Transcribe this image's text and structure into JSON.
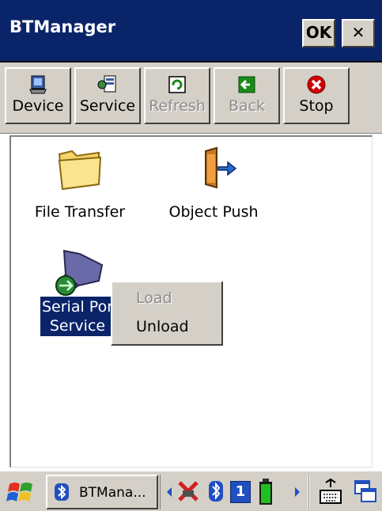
{
  "window": {
    "title": "BTManager",
    "ok_label": "OK",
    "close_symbol": "✕"
  },
  "toolbar": {
    "buttons": [
      {
        "label": "Device",
        "icon": "device-icon",
        "enabled": true
      },
      {
        "label": "Service",
        "icon": "service-icon",
        "enabled": true
      },
      {
        "label": "Refresh",
        "icon": "refresh-icon",
        "enabled": false
      },
      {
        "label": "Back",
        "icon": "back-arrow-icon",
        "enabled": false
      },
      {
        "label": "Stop",
        "icon": "stop-icon",
        "enabled": true
      }
    ]
  },
  "services": [
    {
      "label": "File Transfer",
      "icon": "folder-icon"
    },
    {
      "label": "Object Push",
      "icon": "object-push-icon"
    },
    {
      "label_line1": "Serial Por",
      "label_line2": "Service",
      "icon": "serial-port-icon",
      "selected": true
    }
  ],
  "context_menu": {
    "items": [
      {
        "label": "Load",
        "enabled": false
      },
      {
        "label": "Unload",
        "enabled": true
      }
    ]
  },
  "taskbar": {
    "task_label": "BTMana...",
    "tray_number": "1",
    "icons": [
      "start-flag-icon",
      "bluetooth-icon",
      "network-x-icon",
      "battery-icon",
      "keyboard-icon",
      "switch-window-icon"
    ]
  },
  "colors": {
    "title_bar": "#0a246a",
    "chrome": "#d4d0c8",
    "selection": "#0a246a",
    "back_green": "#1a8a1a",
    "stop_red": "#d00000"
  }
}
